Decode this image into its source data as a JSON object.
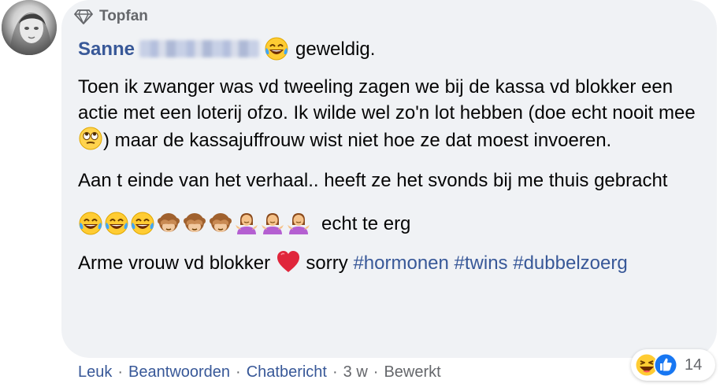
{
  "badge": {
    "label": "Topfan",
    "icon": "diamond-icon"
  },
  "comment": {
    "author": "Sanne",
    "author_suffix": "geweldig.",
    "paragraph1": "Toen ik zwanger was vd tweeling zagen we bij de kassa vd blokker een actie met een loterij ofzo. Ik wilde wel zo'n lot hebben (doe echt nooit mee",
    "paragraph1_after": ") maar de kassajuffrouw wist niet hoe ze dat moest invoeren.",
    "paragraph2": "Aan t einde van het verhaal.. heeft ze het svonds bij me thuis gebracht",
    "emoji_line_text": "echt te erg",
    "last_line_start": "Arme vrouw vd blokker",
    "last_line_mid": "sorry",
    "hashtags": [
      "#hormonen",
      "#twins",
      "#dubbelzoerg"
    ]
  },
  "actions": {
    "like": "Leuk",
    "reply": "Beantwoorden",
    "chat": "Chatbericht",
    "time": "3 w",
    "edited": "Bewerkt"
  },
  "reactions": {
    "count": "14",
    "icons": [
      "haha-icon",
      "like-icon"
    ]
  },
  "colors": {
    "link": "#385898",
    "bubble": "#f0f2f5",
    "meta": "#65676b",
    "like_blue": "#1877f2"
  }
}
